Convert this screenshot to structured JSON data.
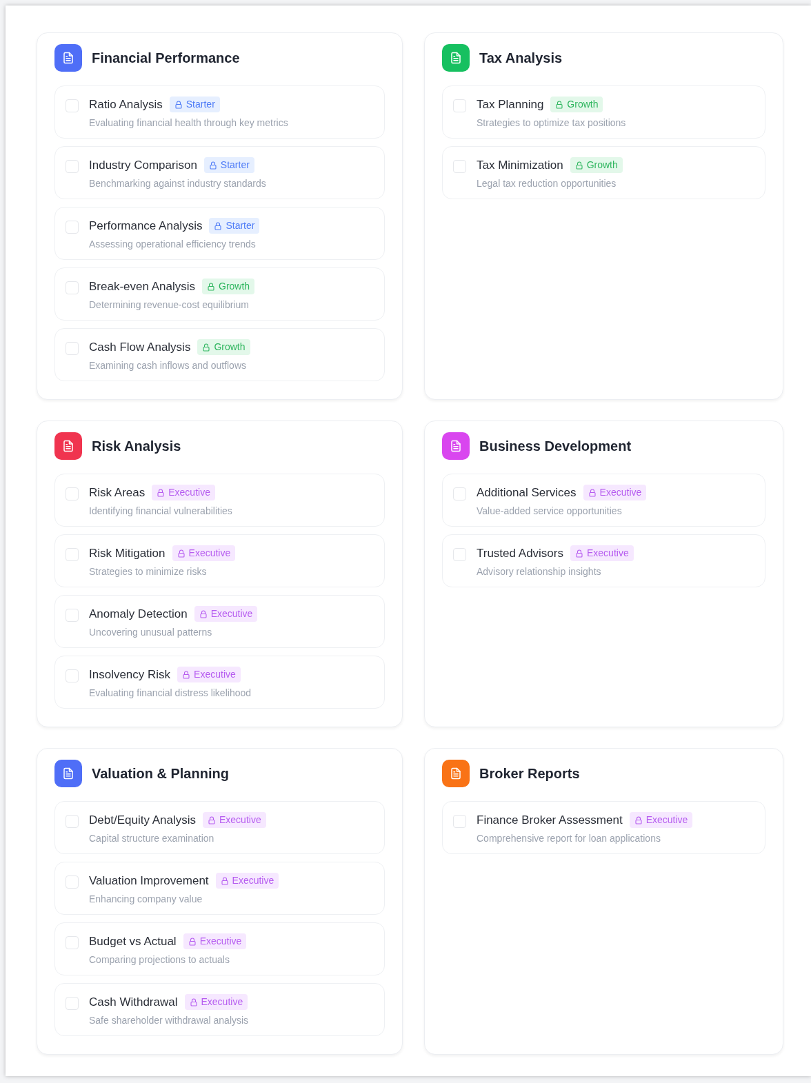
{
  "sections": [
    {
      "title": "Financial Performance",
      "color": "#4f6ef7",
      "items": [
        {
          "title": "Ratio Analysis",
          "badge": {
            "label": "Starter",
            "kind": "starter"
          },
          "description": "Evaluating financial health through key metrics",
          "checked": false
        },
        {
          "title": "Industry Comparison",
          "badge": {
            "label": "Starter",
            "kind": "starter"
          },
          "description": "Benchmarking against industry standards",
          "checked": false
        },
        {
          "title": "Performance Analysis",
          "badge": {
            "label": "Starter",
            "kind": "starter"
          },
          "description": "Assessing operational efficiency trends",
          "checked": false
        },
        {
          "title": "Break-even Analysis",
          "badge": {
            "label": "Growth",
            "kind": "growth"
          },
          "description": "Determining revenue-cost equilibrium",
          "checked": false
        },
        {
          "title": "Cash Flow Analysis",
          "badge": {
            "label": "Growth",
            "kind": "growth"
          },
          "description": "Examining cash inflows and outflows",
          "checked": false
        }
      ]
    },
    {
      "title": "Tax Analysis",
      "color": "#16c060",
      "items": [
        {
          "title": "Tax Planning",
          "badge": {
            "label": "Growth",
            "kind": "growth"
          },
          "description": "Strategies to optimize tax positions",
          "checked": false
        },
        {
          "title": "Tax Minimization",
          "badge": {
            "label": "Growth",
            "kind": "growth"
          },
          "description": "Legal tax reduction opportunities",
          "checked": false
        }
      ]
    },
    {
      "title": "Risk Analysis",
      "color": "#f0344f",
      "items": [
        {
          "title": "Risk Areas",
          "badge": {
            "label": "Executive",
            "kind": "executive"
          },
          "description": "Identifying financial vulnerabilities",
          "checked": false
        },
        {
          "title": "Risk Mitigation",
          "badge": {
            "label": "Executive",
            "kind": "executive"
          },
          "description": "Strategies to minimize risks",
          "checked": false
        },
        {
          "title": "Anomaly Detection",
          "badge": {
            "label": "Executive",
            "kind": "executive"
          },
          "description": "Uncovering unusual patterns",
          "checked": false
        },
        {
          "title": "Insolvency Risk",
          "badge": {
            "label": "Executive",
            "kind": "executive"
          },
          "description": "Evaluating financial distress likelihood",
          "checked": false
        }
      ]
    },
    {
      "title": "Business Development",
      "color": "#d946ef",
      "items": [
        {
          "title": "Additional Services",
          "badge": {
            "label": "Executive",
            "kind": "executive"
          },
          "description": "Value-added service opportunities",
          "checked": false
        },
        {
          "title": "Trusted Advisors",
          "badge": {
            "label": "Executive",
            "kind": "executive"
          },
          "description": "Advisory relationship insights",
          "checked": false
        }
      ]
    },
    {
      "title": "Valuation & Planning",
      "color": "#4f6ef7",
      "items": [
        {
          "title": "Debt/Equity Analysis",
          "badge": {
            "label": "Executive",
            "kind": "executive"
          },
          "description": "Capital structure examination",
          "checked": false
        },
        {
          "title": "Valuation Improvement",
          "badge": {
            "label": "Executive",
            "kind": "executive"
          },
          "description": "Enhancing company value",
          "checked": false
        },
        {
          "title": "Budget vs Actual",
          "badge": {
            "label": "Executive",
            "kind": "executive"
          },
          "description": "Comparing projections to actuals",
          "checked": false
        },
        {
          "title": "Cash Withdrawal",
          "badge": {
            "label": "Executive",
            "kind": "executive"
          },
          "description": "Safe shareholder withdrawal analysis",
          "checked": false
        }
      ]
    },
    {
      "title": "Broker Reports",
      "color": "#f97316",
      "items": [
        {
          "title": "Finance Broker Assessment",
          "badge": {
            "label": "Executive",
            "kind": "executive"
          },
          "description": "Comprehensive report for loan applications",
          "checked": false
        }
      ]
    }
  ]
}
